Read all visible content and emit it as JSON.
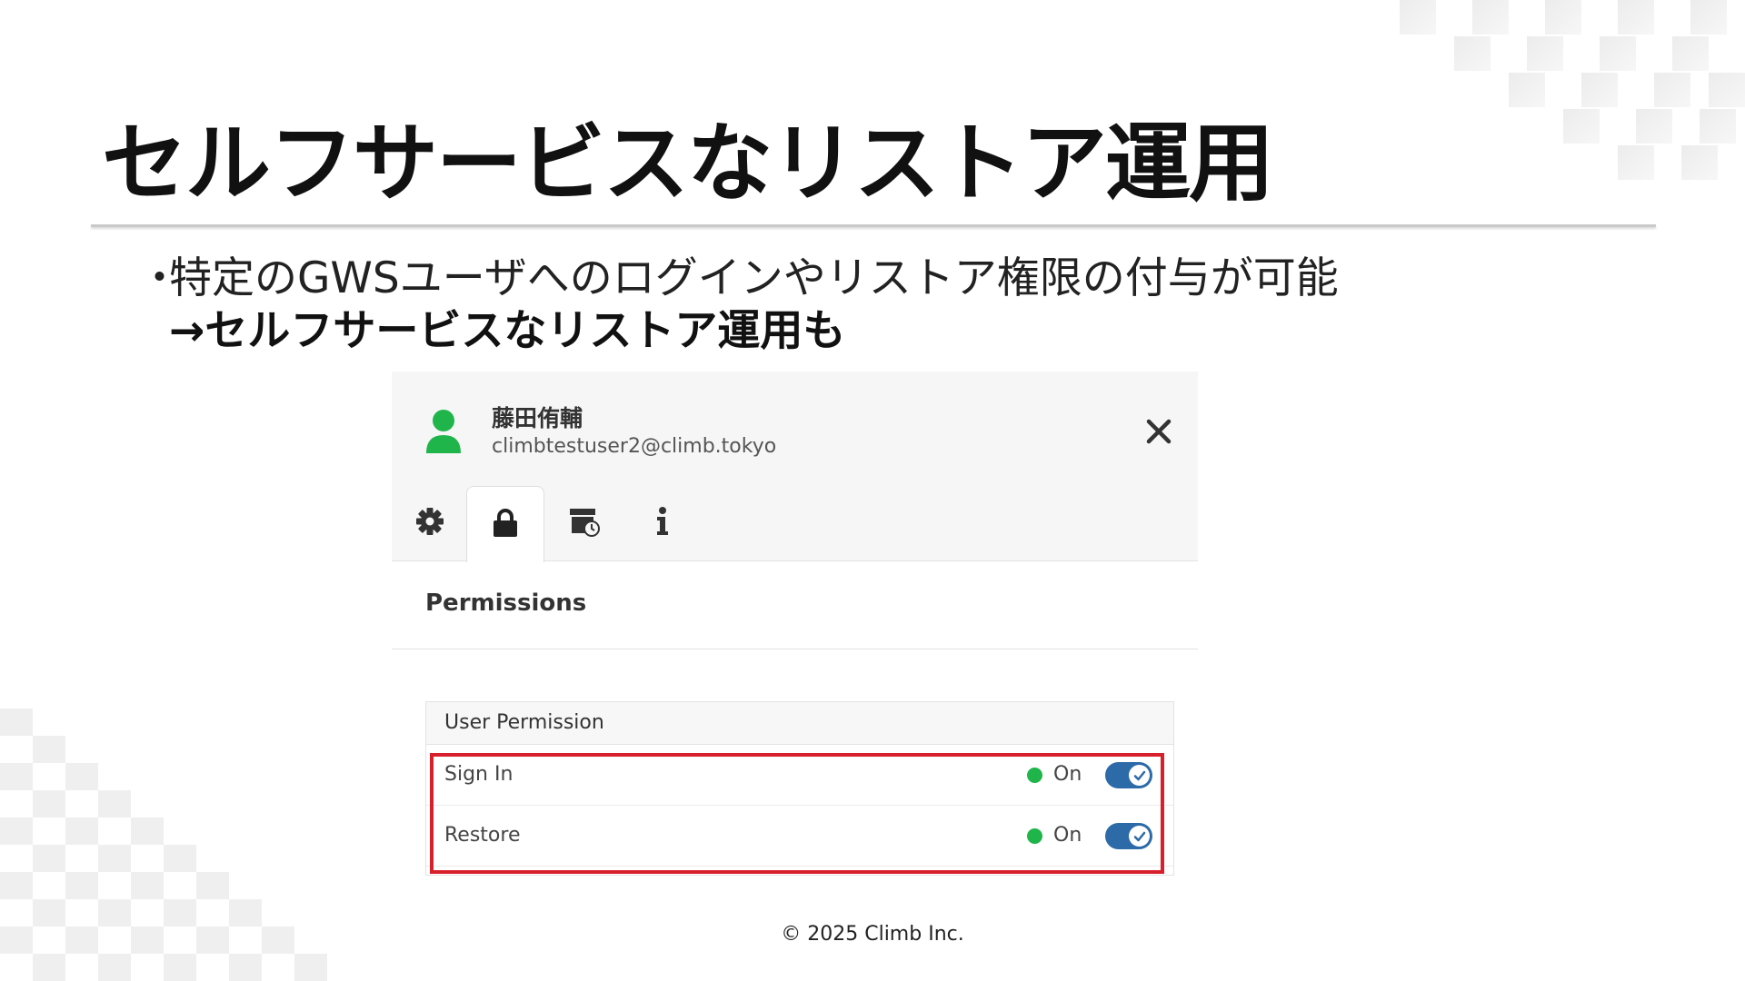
{
  "slide": {
    "title": "セルフサービスなリストア運用",
    "bullet": {
      "marker": "・",
      "line1": "特定のGWSユーザへのログインやリストア権限の付与が可能",
      "line2": "→セルフサービスなリストア運用も"
    },
    "footer": "© 2025 Climb Inc."
  },
  "panel": {
    "user": {
      "name": "藤田侑輔",
      "email": "climbtestuser2@climb.tokyo",
      "avatar_icon": "user-icon",
      "avatar_color": "#1fb54a"
    },
    "close_icon": "close-icon",
    "tabs": [
      {
        "icon": "gear-icon",
        "active": false
      },
      {
        "icon": "lock-icon",
        "active": true
      },
      {
        "icon": "archive-clock-icon",
        "active": false
      },
      {
        "icon": "info-icon",
        "active": false
      }
    ],
    "section_title": "Permissions",
    "permission_table": {
      "header": "User Permission",
      "rows": [
        {
          "label": "Sign In",
          "status": "On",
          "enabled": true
        },
        {
          "label": "Restore",
          "status": "On",
          "enabled": true
        }
      ]
    }
  },
  "colors": {
    "accent": "#2d6aa8",
    "status_on": "#1fb54a",
    "highlight": "#d8202c"
  }
}
